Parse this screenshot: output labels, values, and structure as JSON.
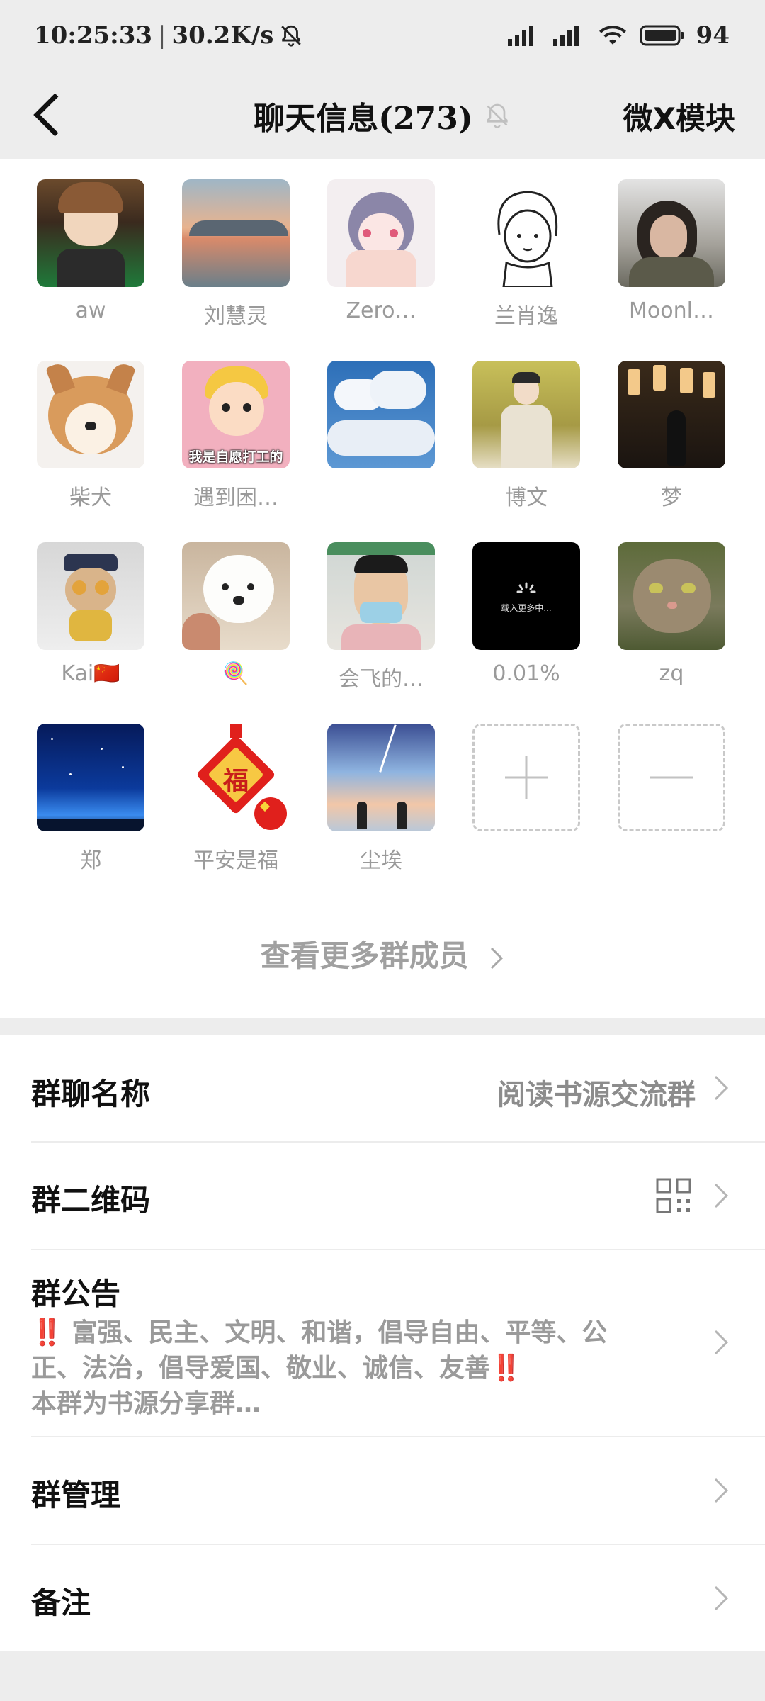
{
  "status": {
    "time": "10:25:33",
    "speed": "30.2K/s",
    "battery": "94"
  },
  "header": {
    "title": "聊天信息(273)",
    "right_label": "微X模块"
  },
  "members": [
    {
      "name": "aw"
    },
    {
      "name": "刘慧灵"
    },
    {
      "name": "Zero…"
    },
    {
      "name": "兰肖逸"
    },
    {
      "name": "Moonl…"
    },
    {
      "name": "柴犬"
    },
    {
      "name": "遇到困…",
      "avatar_caption": "我是自愿打工的"
    },
    {
      "name": ""
    },
    {
      "name": "博文"
    },
    {
      "name": "梦"
    },
    {
      "name": "Kai🇨🇳"
    },
    {
      "name": "🍭"
    },
    {
      "name": "会飞的…"
    },
    {
      "name": "0.01%",
      "avatar_caption": "载入更多中..."
    },
    {
      "name": "zq"
    },
    {
      "name": "郑"
    },
    {
      "name": "平安是福",
      "avatar_caption": "福"
    },
    {
      "name": "尘埃"
    }
  ],
  "more_members_label": "查看更多群成员",
  "settings": {
    "group_name_label": "群聊名称",
    "group_name_value": "阅读书源交流群",
    "qr_label": "群二维码",
    "notice_label": "群公告",
    "notice_line1_bang": "‼️",
    "notice_line1": " 富强、民主、文明、和谐，倡导自由、平等、公",
    "notice_line2": "正、法治，倡导爱国、敬业、诚信、友善",
    "notice_line2_bang": "‼️",
    "notice_line3": "本群为书源分享群…",
    "manage_label": "群管理",
    "remark_label": "备注"
  }
}
